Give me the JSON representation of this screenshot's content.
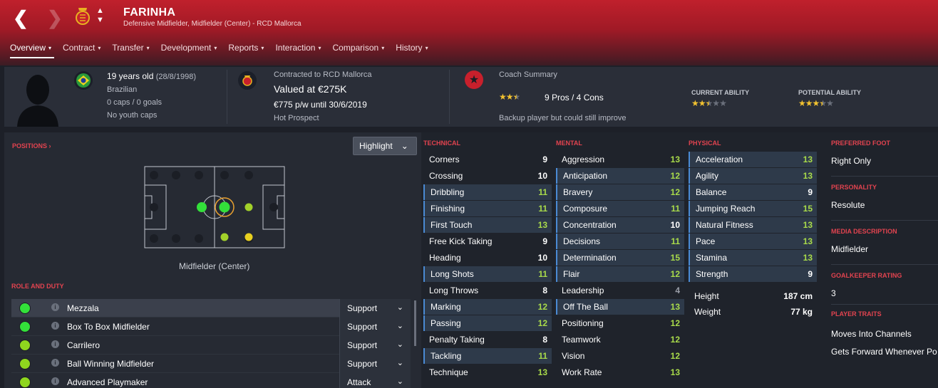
{
  "header": {
    "player_name": "FARINHA",
    "subtitle": "Defensive Midfielder, Midfielder (Center) - RCD Mallorca",
    "tabs": [
      {
        "label": "Overview"
      },
      {
        "label": "Contract"
      },
      {
        "label": "Transfer"
      },
      {
        "label": "Development"
      },
      {
        "label": "Reports"
      },
      {
        "label": "Interaction"
      },
      {
        "label": "Comparison"
      },
      {
        "label": "History"
      }
    ]
  },
  "info_bar": {
    "age": "19 years old",
    "dob": "(28/8/1998)",
    "nationality": "Brazilian",
    "caps": "0 caps / 0 goals",
    "youth_caps": "No youth caps",
    "contracted": "Contracted to RCD Mallorca",
    "valued": "Valued at €275K",
    "wage": "€775 p/w until 30/6/2019",
    "prospect": "Hot Prospect",
    "coach_summary_label": "Coach Summary",
    "pros_cons": "9 Pros / 4 Cons",
    "coach_note": "Backup player but could still improve",
    "current_ability_label": "CURRENT ABILITY",
    "potential_ability_label": "POTENTIAL ABILITY",
    "coach_stars": 2.5,
    "current_ability_stars": 2.5,
    "potential_ability_stars": 3.5,
    "max_stars": 5
  },
  "positions": {
    "title": "POSITIONS",
    "highlight_label": "Highlight",
    "position_label": "Midfielder (Center)"
  },
  "roles": {
    "title": "ROLE AND DUTY",
    "items": [
      {
        "name": "Mezzala",
        "duty": "Support",
        "color": "#33e03a"
      },
      {
        "name": "Box To Box Midfielder",
        "duty": "Support",
        "color": "#33e03a"
      },
      {
        "name": "Carrilero",
        "duty": "Support",
        "color": "#8fd61e"
      },
      {
        "name": "Ball Winning Midfielder",
        "duty": "Support",
        "color": "#8fd61e"
      },
      {
        "name": "Advanced Playmaker",
        "duty": "Attack",
        "color": "#8fd61e"
      }
    ]
  },
  "technical": {
    "title": "TECHNICAL",
    "items": [
      {
        "name": "Corners",
        "value": "9"
      },
      {
        "name": "Crossing",
        "value": "10"
      },
      {
        "name": "Dribbling",
        "value": "11"
      },
      {
        "name": "Finishing",
        "value": "11"
      },
      {
        "name": "First Touch",
        "value": "13"
      },
      {
        "name": "Free Kick Taking",
        "value": "9"
      },
      {
        "name": "Heading",
        "value": "10"
      },
      {
        "name": "Long Shots",
        "value": "11"
      },
      {
        "name": "Long Throws",
        "value": "8"
      },
      {
        "name": "Marking",
        "value": "12"
      },
      {
        "name": "Passing",
        "value": "12"
      },
      {
        "name": "Penalty Taking",
        "value": "8"
      },
      {
        "name": "Tackling",
        "value": "11"
      },
      {
        "name": "Technique",
        "value": "13"
      }
    ]
  },
  "mental": {
    "title": "MENTAL",
    "items": [
      {
        "name": "Aggression",
        "value": "13"
      },
      {
        "name": "Anticipation",
        "value": "12"
      },
      {
        "name": "Bravery",
        "value": "12"
      },
      {
        "name": "Composure",
        "value": "11"
      },
      {
        "name": "Concentration",
        "value": "10"
      },
      {
        "name": "Decisions",
        "value": "11"
      },
      {
        "name": "Determination",
        "value": "15"
      },
      {
        "name": "Flair",
        "value": "12"
      },
      {
        "name": "Leadership",
        "value": "4"
      },
      {
        "name": "Off The Ball",
        "value": "13"
      },
      {
        "name": "Positioning",
        "value": "12"
      },
      {
        "name": "Teamwork",
        "value": "12"
      },
      {
        "name": "Vision",
        "value": "12"
      },
      {
        "name": "Work Rate",
        "value": "13"
      }
    ]
  },
  "physical": {
    "title": "PHYSICAL",
    "items": [
      {
        "name": "Acceleration",
        "value": "13"
      },
      {
        "name": "Agility",
        "value": "13"
      },
      {
        "name": "Balance",
        "value": "9"
      },
      {
        "name": "Jumping Reach",
        "value": "15"
      },
      {
        "name": "Natural Fitness",
        "value": "13"
      },
      {
        "name": "Pace",
        "value": "13"
      },
      {
        "name": "Stamina",
        "value": "13"
      },
      {
        "name": "Strength",
        "value": "9"
      }
    ],
    "height_label": "Height",
    "height_value": "187 cm",
    "weight_label": "Weight",
    "weight_value": "77 kg"
  },
  "right_info": {
    "preferred_foot_label": "PREFERRED FOOT",
    "preferred_foot": "Right Only",
    "personality_label": "PERSONALITY",
    "personality": "Resolute",
    "media_label": "MEDIA DESCRIPTION",
    "media": "Midfielder",
    "gk_label": "GOALKEEPER RATING",
    "gk_rating": "3",
    "traits_label": "PLAYER TRAITS",
    "traits": [
      "Moves Into Channels",
      "Gets Forward Whenever Po"
    ]
  },
  "colors": {
    "accent_red": "#c8202c",
    "attr_green": "#a9db4a",
    "highlight_blue": "#4a8ad4"
  }
}
